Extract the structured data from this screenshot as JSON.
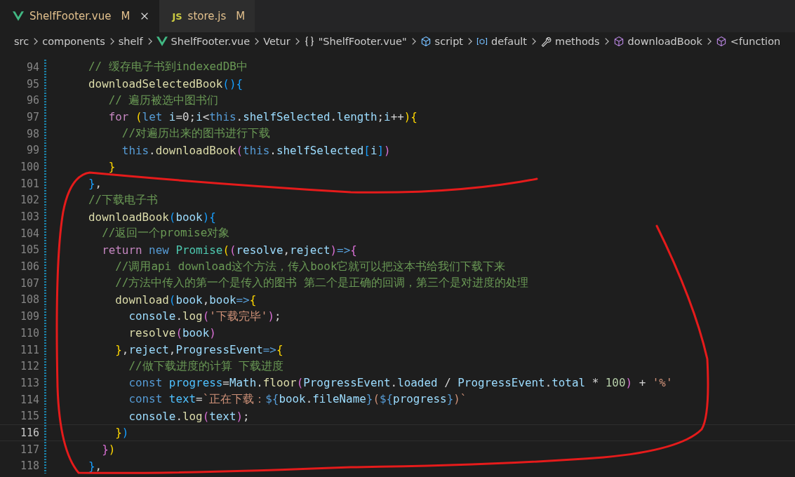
{
  "tabs": [
    {
      "label": "ShelfFooter.vue",
      "kind": "vue",
      "status": "M",
      "selected": true
    },
    {
      "label": "store.js",
      "kind": "js",
      "badge": "JS",
      "status": "M",
      "selected": false
    }
  ],
  "breadcrumb": [
    {
      "label": "src",
      "kind": "none"
    },
    {
      "label": "components",
      "kind": "none"
    },
    {
      "label": "shelf",
      "kind": "none"
    },
    {
      "label": "ShelfFooter.vue",
      "kind": "vue"
    },
    {
      "label": "Vetur",
      "kind": "none"
    },
    {
      "label": "\"ShelfFooter.vue\"",
      "kind": "braces"
    },
    {
      "label": "script",
      "kind": "module"
    },
    {
      "label": "default",
      "kind": "variable"
    },
    {
      "label": "methods",
      "kind": "wrench"
    },
    {
      "label": "downloadBook",
      "kind": "method"
    },
    {
      "label": "<function",
      "kind": "method"
    }
  ],
  "lines": [
    {
      "number": "94",
      "current": false,
      "tokens": [
        {
          "kind": "comment",
          "text": "// 缓存电子书到indexedDB中"
        }
      ]
    },
    {
      "number": "95",
      "current": false,
      "tokens": [
        {
          "kind": "function",
          "text": "downloadSelectedBook"
        },
        {
          "kind": "bracket3",
          "text": "(){"
        }
      ]
    },
    {
      "number": "96",
      "current": false,
      "tokens": [
        {
          "kind": "comment",
          "text": "   // 遍历被选中图书们"
        }
      ]
    },
    {
      "number": "97",
      "current": false,
      "tokens": [
        {
          "kind": "control",
          "text": "   for "
        },
        {
          "kind": "bracket1",
          "text": "("
        },
        {
          "kind": "keyword",
          "text": "let "
        },
        {
          "kind": "variable",
          "text": "i"
        },
        {
          "kind": "plain",
          "text": "=0;"
        },
        {
          "kind": "variable",
          "text": "i"
        },
        {
          "kind": "plain",
          "text": "<"
        },
        {
          "kind": "keyword",
          "text": "this"
        },
        {
          "kind": "plain",
          "text": "."
        },
        {
          "kind": "variable",
          "text": "shelfSelected"
        },
        {
          "kind": "plain",
          "text": "."
        },
        {
          "kind": "variable",
          "text": "length"
        },
        {
          "kind": "plain",
          "text": ";"
        },
        {
          "kind": "variable",
          "text": "i"
        },
        {
          "kind": "plain",
          "text": "++"
        },
        {
          "kind": "bracket1",
          "text": "){"
        }
      ]
    },
    {
      "number": "98",
      "current": false,
      "tokens": [
        {
          "kind": "comment",
          "text": "     //对遍历出来的图书进行下载"
        }
      ]
    },
    {
      "number": "99",
      "current": false,
      "tokens": [
        {
          "kind": "keyword",
          "text": "     this"
        },
        {
          "kind": "plain",
          "text": "."
        },
        {
          "kind": "function",
          "text": "downloadBook"
        },
        {
          "kind": "bracket2",
          "text": "("
        },
        {
          "kind": "keyword",
          "text": "this"
        },
        {
          "kind": "plain",
          "text": "."
        },
        {
          "kind": "variable",
          "text": "shelfSelected"
        },
        {
          "kind": "bracket3",
          "text": "["
        },
        {
          "kind": "variable",
          "text": "i"
        },
        {
          "kind": "bracket3",
          "text": "]"
        },
        {
          "kind": "bracket2",
          "text": ")"
        }
      ]
    },
    {
      "number": "100",
      "current": false,
      "tokens": [
        {
          "kind": "bracket1",
          "text": "   }"
        }
      ]
    },
    {
      "number": "101",
      "current": false,
      "tokens": [
        {
          "kind": "bracket3",
          "text": "}"
        },
        {
          "kind": "plain",
          "text": ","
        }
      ]
    },
    {
      "number": "102",
      "current": false,
      "tokens": [
        {
          "kind": "comment",
          "text": "//下载电子书"
        }
      ]
    },
    {
      "number": "103",
      "current": false,
      "tokens": [
        {
          "kind": "function",
          "text": "downloadBook"
        },
        {
          "kind": "bracket3",
          "text": "("
        },
        {
          "kind": "variable",
          "text": "book"
        },
        {
          "kind": "bracket3",
          "text": "){"
        }
      ]
    },
    {
      "number": "104",
      "current": false,
      "tokens": [
        {
          "kind": "comment",
          "text": "  //返回一个promise对象"
        }
      ]
    },
    {
      "number": "105",
      "current": false,
      "tokens": [
        {
          "kind": "control",
          "text": "  return "
        },
        {
          "kind": "keyword",
          "text": "new "
        },
        {
          "kind": "class",
          "text": "Promise"
        },
        {
          "kind": "bracket1",
          "text": "("
        },
        {
          "kind": "bracket2",
          "text": "("
        },
        {
          "kind": "variable",
          "text": "resolve"
        },
        {
          "kind": "plain",
          "text": ","
        },
        {
          "kind": "variable",
          "text": "reject"
        },
        {
          "kind": "bracket2",
          "text": ")"
        },
        {
          "kind": "keyword",
          "text": "=>"
        },
        {
          "kind": "bracket2",
          "text": "{"
        }
      ]
    },
    {
      "number": "106",
      "current": false,
      "tokens": [
        {
          "kind": "comment",
          "text": "    //调用api download这个方法，传入book它就可以把这本书给我们下载下来"
        }
      ]
    },
    {
      "number": "107",
      "current": false,
      "tokens": [
        {
          "kind": "comment",
          "text": "    //方法中传入的第一个是传入的图书 第二个是正确的回调，第三个是对进度的处理"
        }
      ]
    },
    {
      "number": "108",
      "current": false,
      "tokens": [
        {
          "kind": "function",
          "text": "    download"
        },
        {
          "kind": "bracket3",
          "text": "("
        },
        {
          "kind": "variable",
          "text": "book"
        },
        {
          "kind": "plain",
          "text": ","
        },
        {
          "kind": "variable",
          "text": "book"
        },
        {
          "kind": "keyword",
          "text": "=>"
        },
        {
          "kind": "bracket1",
          "text": "{"
        }
      ]
    },
    {
      "number": "109",
      "current": false,
      "tokens": [
        {
          "kind": "variable",
          "text": "      console"
        },
        {
          "kind": "plain",
          "text": "."
        },
        {
          "kind": "function",
          "text": "log"
        },
        {
          "kind": "bracket2",
          "text": "("
        },
        {
          "kind": "string",
          "text": "'下载完毕'"
        },
        {
          "kind": "bracket2",
          "text": ")"
        },
        {
          "kind": "plain",
          "text": ";"
        }
      ]
    },
    {
      "number": "110",
      "current": false,
      "tokens": [
        {
          "kind": "function",
          "text": "      resolve"
        },
        {
          "kind": "bracket2",
          "text": "("
        },
        {
          "kind": "variable",
          "text": "book"
        },
        {
          "kind": "bracket2",
          "text": ")"
        }
      ]
    },
    {
      "number": "111",
      "current": false,
      "tokens": [
        {
          "kind": "bracket1",
          "text": "    }"
        },
        {
          "kind": "plain",
          "text": ","
        },
        {
          "kind": "variable",
          "text": "reject"
        },
        {
          "kind": "plain",
          "text": ","
        },
        {
          "kind": "variable",
          "text": "ProgressEvent"
        },
        {
          "kind": "keyword",
          "text": "=>"
        },
        {
          "kind": "bracket1",
          "text": "{"
        }
      ]
    },
    {
      "number": "112",
      "current": false,
      "tokens": [
        {
          "kind": "comment",
          "text": "      //做下载进度的计算 下载进度"
        }
      ]
    },
    {
      "number": "113",
      "current": false,
      "tokens": [
        {
          "kind": "keyword",
          "text": "      const "
        },
        {
          "kind": "constant",
          "text": "progress"
        },
        {
          "kind": "plain",
          "text": "="
        },
        {
          "kind": "variable",
          "text": "Math"
        },
        {
          "kind": "plain",
          "text": "."
        },
        {
          "kind": "function",
          "text": "floor"
        },
        {
          "kind": "bracket2",
          "text": "("
        },
        {
          "kind": "variable",
          "text": "ProgressEvent"
        },
        {
          "kind": "plain",
          "text": "."
        },
        {
          "kind": "variable",
          "text": "loaded"
        },
        {
          "kind": "plain",
          "text": " / "
        },
        {
          "kind": "variable",
          "text": "ProgressEvent"
        },
        {
          "kind": "plain",
          "text": "."
        },
        {
          "kind": "variable",
          "text": "total"
        },
        {
          "kind": "plain",
          "text": " * "
        },
        {
          "kind": "number",
          "text": "100"
        },
        {
          "kind": "bracket2",
          "text": ")"
        },
        {
          "kind": "plain",
          "text": " + "
        },
        {
          "kind": "string",
          "text": "'%'"
        }
      ]
    },
    {
      "number": "114",
      "current": false,
      "tokens": [
        {
          "kind": "keyword",
          "text": "      const "
        },
        {
          "kind": "constant",
          "text": "text"
        },
        {
          "kind": "plain",
          "text": "="
        },
        {
          "kind": "string",
          "text": "`正在下载："
        },
        {
          "kind": "keyword",
          "text": "${"
        },
        {
          "kind": "variable",
          "text": "book"
        },
        {
          "kind": "plain",
          "text": "."
        },
        {
          "kind": "variable",
          "text": "fileName"
        },
        {
          "kind": "keyword",
          "text": "}"
        },
        {
          "kind": "string",
          "text": "("
        },
        {
          "kind": "keyword",
          "text": "${"
        },
        {
          "kind": "variable",
          "text": "progress"
        },
        {
          "kind": "keyword",
          "text": "}"
        },
        {
          "kind": "string",
          "text": ")`"
        }
      ]
    },
    {
      "number": "115",
      "current": false,
      "tokens": [
        {
          "kind": "variable",
          "text": "      console"
        },
        {
          "kind": "plain",
          "text": "."
        },
        {
          "kind": "function",
          "text": "log"
        },
        {
          "kind": "bracket2",
          "text": "("
        },
        {
          "kind": "variable",
          "text": "text"
        },
        {
          "kind": "bracket2",
          "text": ")"
        },
        {
          "kind": "plain",
          "text": ";"
        }
      ]
    },
    {
      "number": "116",
      "current": true,
      "tokens": [
        {
          "kind": "bracket1",
          "text": "    }"
        },
        {
          "kind": "bracket3",
          "text": ")"
        }
      ]
    },
    {
      "number": "117",
      "current": false,
      "tokens": [
        {
          "kind": "bracket2",
          "text": "  }"
        },
        {
          "kind": "bracket1",
          "text": ")"
        }
      ]
    },
    {
      "number": "118",
      "current": false,
      "tokens": [
        {
          "kind": "bracket3",
          "text": "}"
        },
        {
          "kind": "plain",
          "text": ","
        }
      ]
    }
  ]
}
